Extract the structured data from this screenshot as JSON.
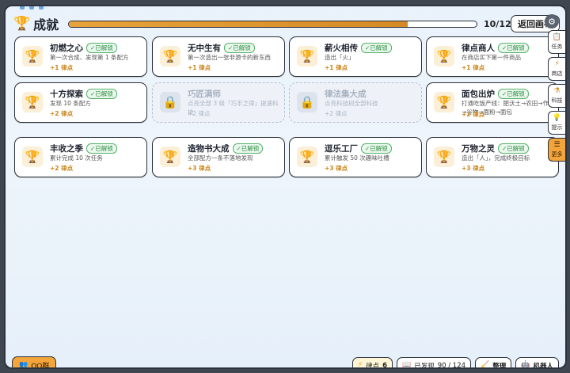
{
  "header": {
    "title": "成就",
    "progress": {
      "current": 10,
      "total": 12,
      "fraction": 0.83
    },
    "progress_text": "10/12",
    "back_label": "返回画布"
  },
  "sidebar": {
    "items": [
      {
        "label": "任务",
        "icon": "clipboard-icon"
      },
      {
        "label": "商店",
        "icon": "bolt-icon"
      },
      {
        "label": "科技",
        "icon": "flask-icon"
      },
      {
        "label": "提示",
        "icon": "lightbulb-icon"
      },
      {
        "label": "更多",
        "icon": "menu-icon",
        "active": true
      }
    ]
  },
  "achievements": [
    {
      "name": "初燃之心",
      "badge": "✓已解锁",
      "desc": "第一次合成、发现第 1 条配方",
      "reward": "+1 律点",
      "unlocked": true
    },
    {
      "name": "无中生有",
      "badge": "✓已解锁",
      "desc": "第一次造出一张非源卡的新东西",
      "reward": "+1 律点",
      "unlocked": true
    },
    {
      "name": "薪火相传",
      "badge": "✓已解锁",
      "desc": "造出「火」",
      "reward": "+1 律点",
      "unlocked": true
    },
    {
      "name": "律点商人",
      "badge": "✓已解锁",
      "desc": "在商店买下第一件商品",
      "reward": "+1 律点",
      "unlocked": true
    },
    {
      "name": "十方探索",
      "badge": "✓已解锁",
      "desc": "发现 10 条配方",
      "reward": "+2 律点",
      "unlocked": true
    },
    {
      "name": "巧匠满师",
      "badge": "",
      "desc": "点亮全部 3 级「巧手之律」提速科技",
      "reward": "+2 律点",
      "unlocked": false
    },
    {
      "name": "律法集大成",
      "badge": "",
      "desc": "点亮科技树全部科技",
      "reward": "+2 律点",
      "unlocked": false
    },
    {
      "name": "面包出炉",
      "badge": "✓已解锁",
      "desc": "打通吃饭产线：肥沃土→农田→作物→谷物→面粉→面包",
      "reward": "+2 律点",
      "unlocked": true
    },
    {
      "name": "丰收之季",
      "badge": "✓已解锁",
      "desc": "累计完成 10 次任务",
      "reward": "+2 律点",
      "unlocked": true
    },
    {
      "name": "造物书大成",
      "badge": "✓已解锁",
      "desc": "全部配方一条不落地发现",
      "reward": "+3 律点",
      "unlocked": true
    },
    {
      "name": "逗乐工厂",
      "badge": "✓已解锁",
      "desc": "累计触发 50 次趣味吐槽",
      "reward": "+3 律点",
      "unlocked": true
    },
    {
      "name": "万物之灵",
      "badge": "✓已解锁",
      "desc": "造出「人」，完成终极目标",
      "reward": "+3 律点",
      "unlocked": true
    }
  ],
  "footer": {
    "qq_label": "QQ群",
    "points_label": "律点",
    "points_value": "6",
    "discovered_label": "已发现",
    "discovered_value": "90 / 124",
    "organize_label": "整理",
    "robot_label": "机器人"
  },
  "colors": {
    "accent": "#f3a43b",
    "unlocked_badge": "#2f8f45",
    "reward": "#c9861c"
  }
}
